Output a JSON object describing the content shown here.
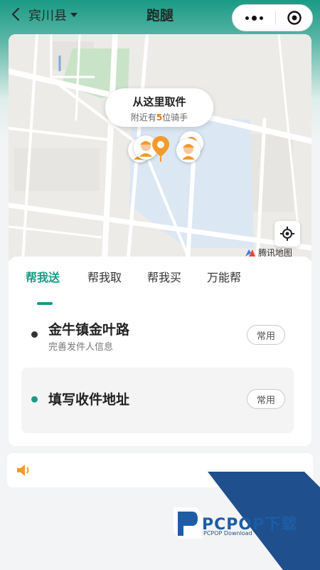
{
  "header": {
    "region": "宾川县",
    "title": "跑腿"
  },
  "map": {
    "bubble_title": "从这里取件",
    "bubble_prefix": "附近有",
    "bubble_count": "5",
    "bubble_suffix": "位骑手",
    "logo_text": "腾讯地图"
  },
  "tabs": [
    {
      "label": "帮我送",
      "active": true
    },
    {
      "label": "帮我取",
      "active": false
    },
    {
      "label": "帮我买",
      "active": false
    },
    {
      "label": "万能帮",
      "active": false
    }
  ],
  "pickup": {
    "address": "金牛镇金叶路",
    "hint": "完善发件人信息",
    "common_label": "常用",
    "bullet_color": "#333333"
  },
  "dropoff": {
    "placeholder": "填写收件地址",
    "common_label": "常用",
    "bullet_color": "#1a9a84"
  },
  "watermark": {
    "brand": "PCPOP下载",
    "sub": "PCPOP Download"
  },
  "colors": {
    "accent": "#1a9a84",
    "rider_count": "#e07a1c",
    "pin": "#f29a2e"
  }
}
